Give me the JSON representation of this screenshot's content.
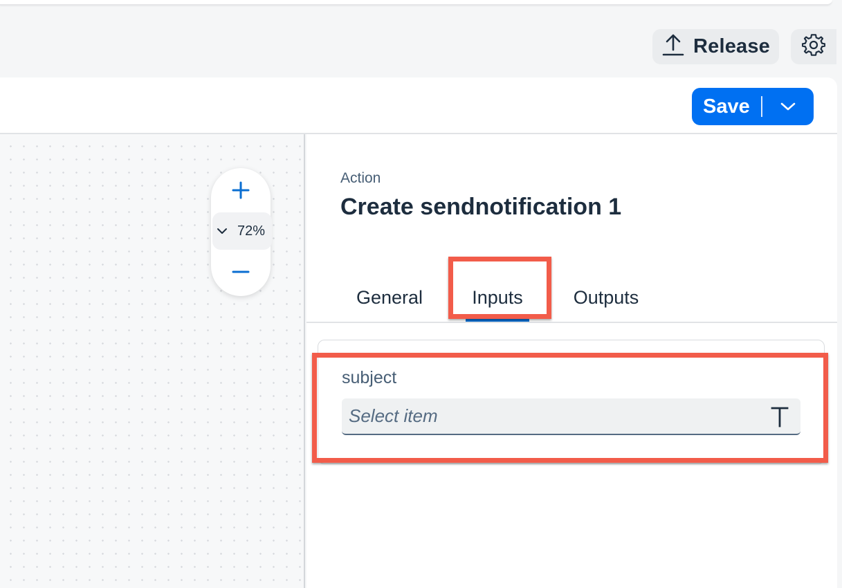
{
  "header": {
    "release_label": "Release",
    "release_icon": "upload-icon",
    "settings_icon": "gear-icon"
  },
  "toolbar": {
    "save_label": "Save",
    "save_menu_icon": "chevron-down-icon"
  },
  "canvas": {
    "zoom_in_icon": "plus-icon",
    "zoom_out_icon": "minus-icon",
    "zoom_level": "72%"
  },
  "panel": {
    "kicker": "Action",
    "title": "Create sendnotification 1",
    "tabs": [
      {
        "label": "General",
        "selected": false
      },
      {
        "label": "Inputs",
        "selected": true
      },
      {
        "label": "Outputs",
        "selected": false
      }
    ],
    "inputs": [
      {
        "label": "subject",
        "value": "",
        "placeholder": "Select item",
        "type_icon": "text-type-icon"
      }
    ]
  },
  "colors": {
    "accent": "#0070f2",
    "highlight": "#f25c4a",
    "text": "#1d2d3e"
  }
}
